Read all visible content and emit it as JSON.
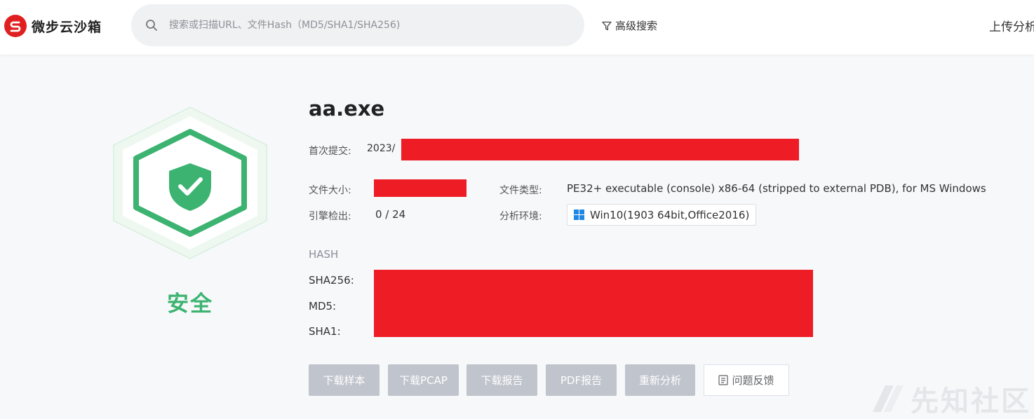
{
  "header": {
    "logo_text": "微步云沙箱",
    "search_placeholder": "搜索或扫描URL、文件Hash（MD5/SHA1/SHA256)",
    "advanced_search": "高级搜索",
    "upload_label": "上传分析"
  },
  "verdict": {
    "label": "安全",
    "color": "#3cb371",
    "icon": "shield-check-icon"
  },
  "file": {
    "name": "aa.exe",
    "first_submit_label": "首次提交:",
    "first_submit_value": "2023/",
    "size_label": "文件大小:",
    "engine_label": "引擎检出:",
    "engine_value": "0 / 24",
    "type_label": "文件类型:",
    "type_value": "PE32+ executable (console) x86-64 (stripped to external PDB), for MS Windows",
    "env_label": "分析环境:",
    "env_value": "Win10(1903 64bit,Office2016)"
  },
  "hash": {
    "heading": "HASH",
    "sha256_label": "SHA256:",
    "md5_label": "MD5:",
    "sha1_label": "SHA1:"
  },
  "actions": {
    "download_sample": "下载样本",
    "download_pcap": "下载PCAP",
    "download_report": "下载报告",
    "pdf_report": "PDF报告",
    "reanalyze": "重新分析",
    "feedback": "问题反馈"
  },
  "watermark": "先知社区",
  "colors": {
    "redaction": "#ee1c25",
    "button_disabled": "#c0c4cc",
    "brand": "#e02020"
  }
}
